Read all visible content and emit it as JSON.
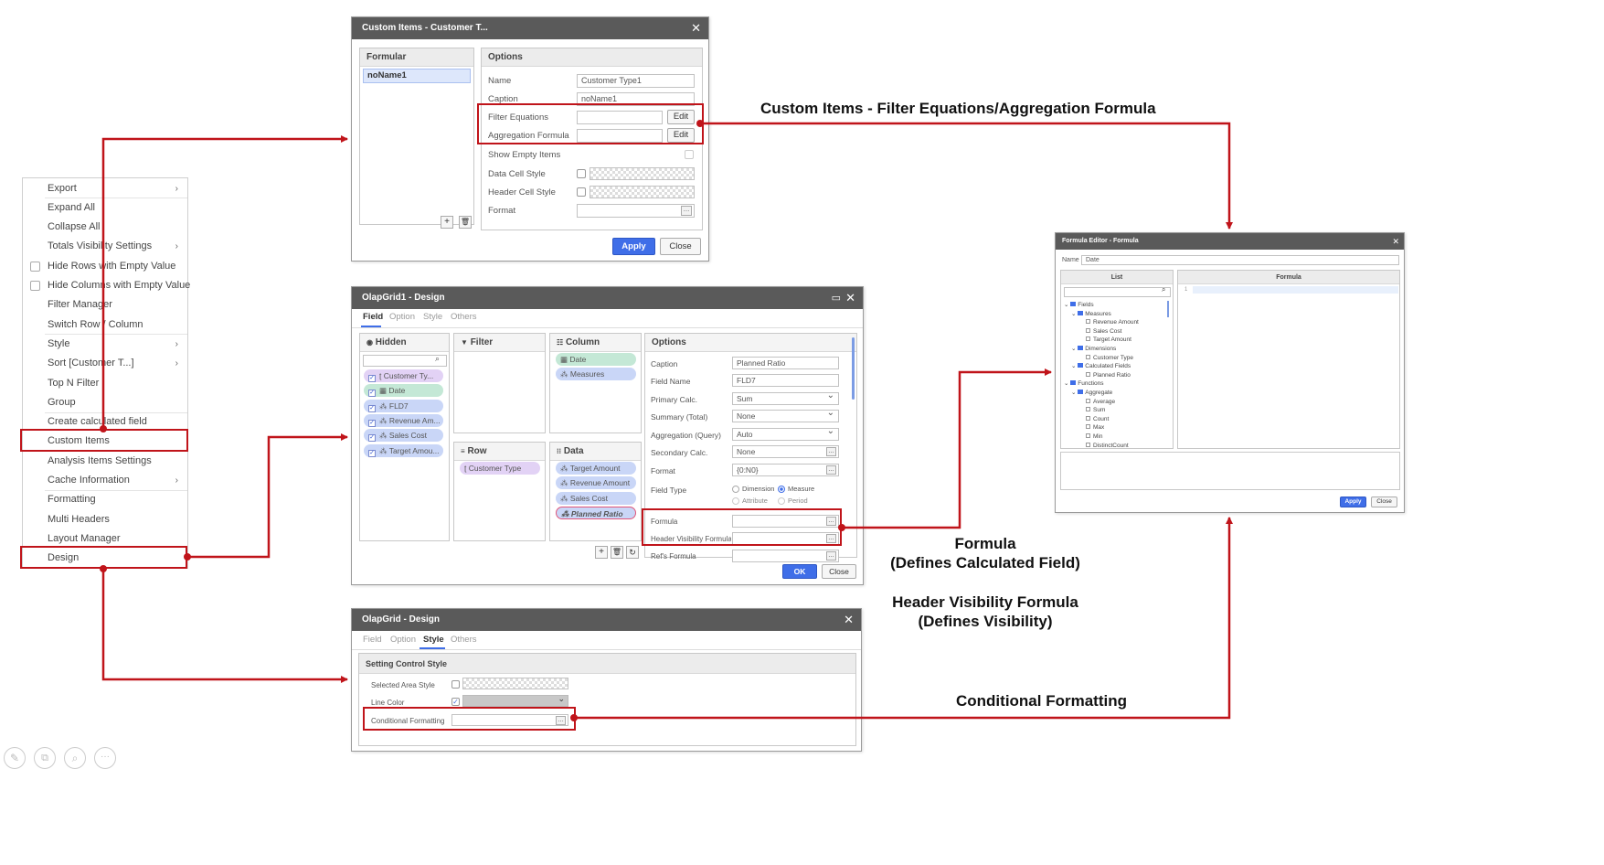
{
  "context_menu": {
    "items": [
      {
        "label": "Export",
        "submenu": true
      },
      {
        "label": "Expand All"
      },
      {
        "label": "Collapse All"
      },
      {
        "label": "Totals Visibility Settings",
        "submenu": true
      },
      {
        "label": "Hide Rows with Empty Value",
        "checkbox": true
      },
      {
        "label": "Hide Columns with Empty Value",
        "checkbox": true
      },
      {
        "label": "Filter Manager"
      },
      {
        "label": "Switch Row / Column"
      },
      {
        "label": "Style",
        "submenu": true
      },
      {
        "label": "Sort [Customer T...]",
        "submenu": true
      },
      {
        "label": "Top N Filter"
      },
      {
        "label": "Group"
      },
      {
        "label": "Create calculated field"
      },
      {
        "label": "Custom Items",
        "highlighted": true
      },
      {
        "label": "Analysis Items Settings"
      },
      {
        "label": "Cache Information",
        "submenu": true
      },
      {
        "label": "Formatting"
      },
      {
        "label": "Multi Headers"
      },
      {
        "label": "Layout Manager"
      },
      {
        "label": "Design",
        "highlighted": true
      }
    ]
  },
  "custom_items_dialog": {
    "title": "Custom Items - Customer T...",
    "formular_header": "Formular",
    "formular_item": "noName1",
    "options_header": "Options",
    "name_label": "Name",
    "name_value": "Customer Type1",
    "caption_label": "Caption",
    "caption_value": "noName1",
    "filter_eq_label": "Filter Equations",
    "agg_formula_label": "Aggregation Formula",
    "edit_label": "Edit",
    "show_empty_label": "Show Empty Items",
    "data_cell_style_label": "Data Cell Style",
    "header_cell_style_label": "Header Cell Style",
    "format_label": "Format",
    "apply_label": "Apply",
    "close_label": "Close"
  },
  "design_dialog": {
    "title": "OlapGrid1 - Design",
    "tabs": [
      "Field",
      "Option",
      "Style",
      "Others"
    ],
    "hidden_header": "Hidden",
    "filter_header": "Filter",
    "column_header": "Column",
    "row_header": "Row",
    "data_header": "Data",
    "options_header": "Options",
    "hidden_fields": [
      "Customer Ty...",
      "Date",
      "FLD7",
      "Revenue Am...",
      "Sales Cost",
      "Target Amou..."
    ],
    "column_fields": [
      "Date",
      "Measures"
    ],
    "row_fields": [
      "Customer Type"
    ],
    "data_fields": [
      "Target Amount",
      "Revenue Amount",
      "Sales Cost",
      "Planned Ratio"
    ],
    "options": {
      "caption_label": "Caption",
      "caption_value": "Planned Ratio",
      "field_name_label": "Field Name",
      "field_name_value": "FLD7",
      "primary_calc_label": "Primary Calc.",
      "primary_calc_value": "Sum",
      "summary_label": "Summary (Total)",
      "summary_value": "None",
      "aggregation_label": "Aggregation (Query)",
      "aggregation_value": "Auto",
      "secondary_calc_label": "Secondary Calc.",
      "secondary_calc_value": "None",
      "format_label": "Format",
      "format_value": "{0:N0}",
      "field_type_label": "Field Type",
      "field_type_options": [
        "Dimension",
        "Measure",
        "Attribute",
        "Period"
      ],
      "formula_label": "Formula",
      "header_vis_label": "Header Visibility Formula",
      "refs_formula_label": "Ref's Formula"
    },
    "ok_label": "OK",
    "close_label": "Close"
  },
  "style_dialog": {
    "title": "OlapGrid - Design",
    "tabs": [
      "Field",
      "Option",
      "Style",
      "Others"
    ],
    "section_header": "Setting Control Style",
    "selected_area_label": "Selected Area Style",
    "line_color_label": "Line Color",
    "cond_format_label": "Conditional Formatting"
  },
  "formula_editor": {
    "title": "Formula Editor - Formula",
    "name_label": "Name",
    "name_value": "Date",
    "list_header": "List",
    "formula_header": "Formula",
    "line_number": "1",
    "tree": [
      {
        "label": "Fields",
        "level": 0,
        "type": "folder"
      },
      {
        "label": "Measures",
        "level": 1,
        "type": "folder"
      },
      {
        "label": "Revenue Amount",
        "level": 2,
        "type": "item"
      },
      {
        "label": "Sales Cost",
        "level": 2,
        "type": "item"
      },
      {
        "label": "Target Amount",
        "level": 2,
        "type": "item"
      },
      {
        "label": "Dimensions",
        "level": 1,
        "type": "folder"
      },
      {
        "label": "Customer Type",
        "level": 2,
        "type": "item"
      },
      {
        "label": "Calculated Fields",
        "level": 1,
        "type": "folder"
      },
      {
        "label": "Planned Ratio",
        "level": 2,
        "type": "item"
      },
      {
        "label": "Functions",
        "level": 0,
        "type": "folder"
      },
      {
        "label": "Aggregate",
        "level": 1,
        "type": "folder"
      },
      {
        "label": "Average",
        "level": 2,
        "type": "item"
      },
      {
        "label": "Sum",
        "level": 2,
        "type": "item"
      },
      {
        "label": "Count",
        "level": 2,
        "type": "item"
      },
      {
        "label": "Max",
        "level": 2,
        "type": "item"
      },
      {
        "label": "Min",
        "level": 2,
        "type": "item"
      },
      {
        "label": "DistinctCount",
        "level": 2,
        "type": "item"
      }
    ],
    "apply_label": "Apply",
    "close_label": "Close"
  },
  "annotations": {
    "custom_items": "Custom Items  - Filter Equations/Aggregation Formula",
    "formula_line1": "Formula",
    "formula_line2": "(Defines Calculated Field)",
    "header_vis_line1": "Header Visibility Formula",
    "header_vis_line2": "(Defines Visibility)",
    "conditional": "Conditional Formatting"
  },
  "colors": {
    "annotation_red": "#c0141a",
    "title_bar": "#5a5a5a",
    "primary_button": "#3f6ee8"
  },
  "bottom_icons": [
    "pencil-icon",
    "copy-icon",
    "zoom-icon",
    "more-icon"
  ]
}
